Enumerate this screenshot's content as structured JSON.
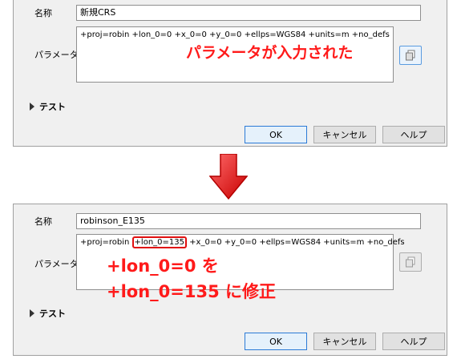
{
  "top": {
    "name_label": "名称",
    "name_value": "新規CRS",
    "param_label": "パラメータ",
    "param_value": "+proj=robin +lon_0=0 +x_0=0 +y_0=0 +ellps=WGS84 +units=m +no_defs",
    "annotation": "パラメータが入力された",
    "test_label": "テスト",
    "ok_label": "OK",
    "cancel_label": "キャンセル",
    "help_label": "ヘルプ"
  },
  "bottom": {
    "name_label": "名称",
    "name_value": "robinson_E135",
    "param_label": "パラメータ",
    "param_before": "+proj=robin ",
    "param_highlight": "+lon_0=135",
    "param_after": " +x_0=0 +y_0=0 +ellps=WGS84 +units=m +no_defs",
    "annotation_line1": "+lon_0=0 を",
    "annotation_line2": "+lon_0=135 に修正",
    "test_label": "テスト",
    "ok_label": "OK",
    "cancel_label": "キャンセル",
    "help_label": "ヘルプ"
  },
  "colors": {
    "annotation_red": "#ff1a1a",
    "arrow_red": "#e01010",
    "default_button_border": "#2b7ad6"
  },
  "icons": {
    "copy": "copy-icon",
    "expand": "expand-triangle-icon",
    "arrow": "down-arrow-icon"
  }
}
